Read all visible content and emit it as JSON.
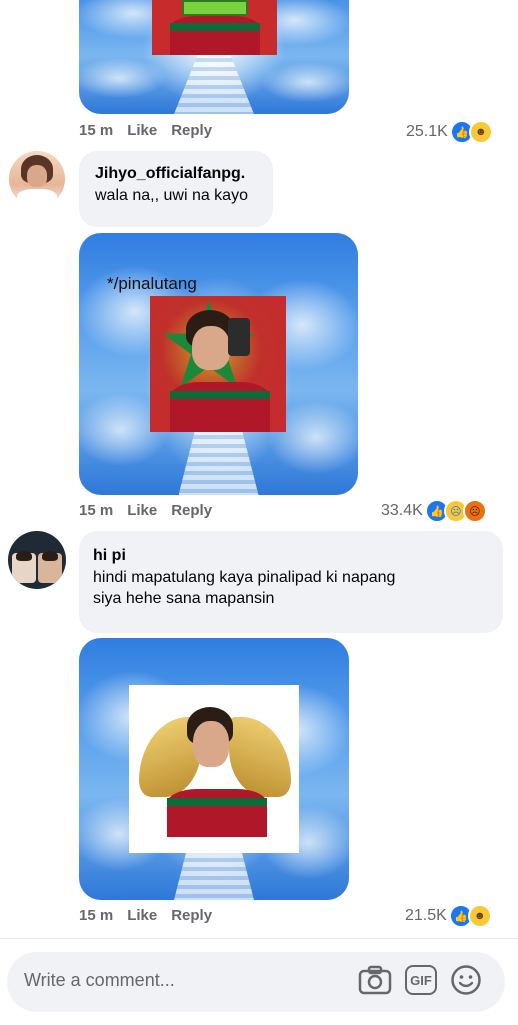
{
  "comments": [
    {
      "time": "15 m",
      "like": "Like",
      "reply": "Reply",
      "count": "25.1K",
      "reactions": [
        "like",
        "haha"
      ]
    },
    {
      "user": "Jihyo_officialfanpg.",
      "text": "wala na,, uwi na kayo",
      "caption": "*/pinalutang",
      "time": "15 m",
      "like": "Like",
      "reply": "Reply",
      "count": "33.4K",
      "reactions": [
        "like",
        "sad",
        "angry"
      ]
    },
    {
      "user": "hi pi",
      "text_line1": "hindi mapatulang kaya pinalipad ki napang",
      "text_line2": "siya hehe sana mapansin",
      "time": "15 m",
      "like": "Like",
      "reply": "Reply",
      "count": "21.5K",
      "reactions": [
        "like",
        "haha"
      ]
    }
  ],
  "composer": {
    "placeholder": "Write a comment...",
    "icons": [
      "camera-icon",
      "gif-icon",
      "emoji-icon"
    ],
    "gif_label": "GIF"
  },
  "colors": {
    "like": "#1877f2",
    "meta": "#65676b",
    "bubble": "#f0f2f5"
  }
}
